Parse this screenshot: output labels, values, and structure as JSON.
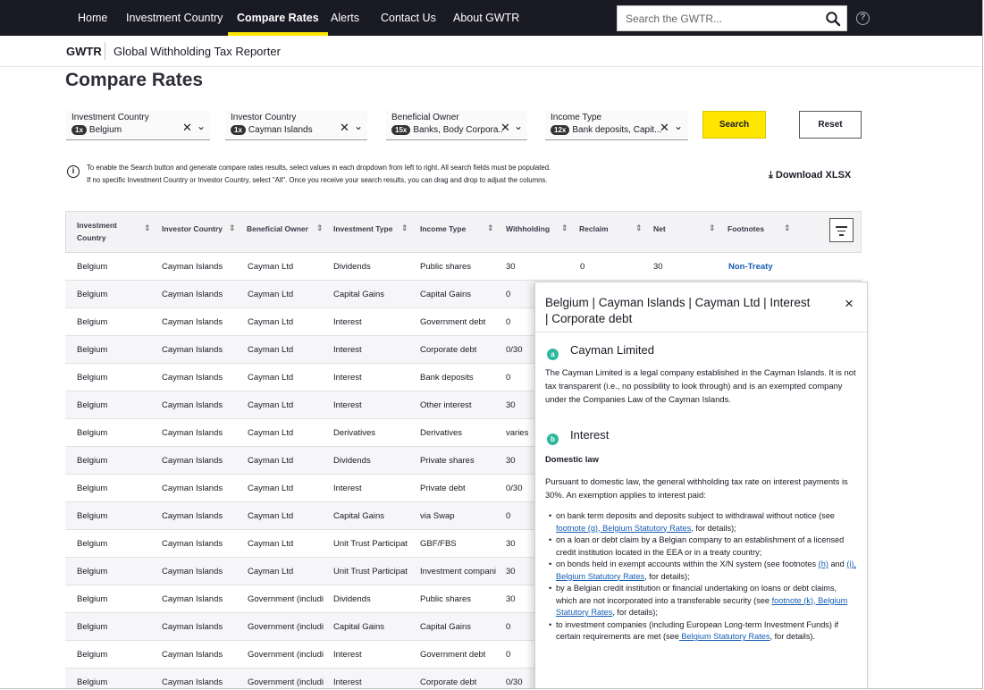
{
  "nav": {
    "items": [
      {
        "label": "Home",
        "active": false
      },
      {
        "label": "Investment Country",
        "active": false
      },
      {
        "label": "Compare Rates",
        "active": true
      },
      {
        "label": "Alerts",
        "active": false
      },
      {
        "label": "Contact Us",
        "active": false
      },
      {
        "label": "About GWTR",
        "active": false
      }
    ],
    "search_placeholder": "Search the GWTR...",
    "help_glyph": "?"
  },
  "breadcrumb": {
    "root": "GWTR",
    "current": "Global Withholding Tax Reporter"
  },
  "page_title": "Compare Rates",
  "filters": [
    {
      "label": "Investment Country",
      "count": "1x",
      "value": "Belgium"
    },
    {
      "label": "Investor Country",
      "count": "1x",
      "value": "Cayman Islands"
    },
    {
      "label": "Beneficial Owner",
      "count": "15x",
      "value": "Banks, Body Corpora..."
    },
    {
      "label": "Income Type",
      "count": "12x",
      "value": "Bank deposits, Capit..."
    }
  ],
  "buttons": {
    "search": "Search",
    "reset": "Reset",
    "download": "Download XLSX"
  },
  "info": {
    "line1": "To enable the Search button and generate compare rates results, select values in each dropdown from left to right. All search fields must be populated.",
    "line2": "If no specific Investment Country or Investor Country, select \"All\". Once you receive your search results, you can drag and drop to adjust the columns."
  },
  "table": {
    "headers": [
      "Investment Country",
      "Investor Country",
      "Beneficial Owner",
      "Investment Type",
      "Income Type",
      "Withholding",
      "Reclaim",
      "Net",
      "Footnotes"
    ],
    "rows": [
      [
        "Belgium",
        "Cayman Islands",
        "Cayman Ltd",
        "Dividends",
        "Public shares",
        "30",
        "0",
        "30",
        "Non-Treaty"
      ],
      [
        "Belgium",
        "Cayman Islands",
        "Cayman Ltd",
        "Capital Gains",
        "Capital Gains",
        "0",
        "",
        "",
        ""
      ],
      [
        "Belgium",
        "Cayman Islands",
        "Cayman Ltd",
        "Interest",
        "Government debt",
        "0",
        "",
        "",
        ""
      ],
      [
        "Belgium",
        "Cayman Islands",
        "Cayman Ltd",
        "Interest",
        "Corporate debt",
        "0/30",
        "",
        "",
        ""
      ],
      [
        "Belgium",
        "Cayman Islands",
        "Cayman Ltd",
        "Interest",
        "Bank deposits",
        "0",
        "",
        "",
        ""
      ],
      [
        "Belgium",
        "Cayman Islands",
        "Cayman Ltd",
        "Interest",
        "Other interest",
        "30",
        "",
        "",
        ""
      ],
      [
        "Belgium",
        "Cayman Islands",
        "Cayman Ltd",
        "Derivatives",
        "Derivatives",
        "varies",
        "",
        "",
        ""
      ],
      [
        "Belgium",
        "Cayman Islands",
        "Cayman Ltd",
        "Dividends",
        "Private shares",
        "30",
        "",
        "",
        ""
      ],
      [
        "Belgium",
        "Cayman Islands",
        "Cayman Ltd",
        "Interest",
        "Private debt",
        "0/30",
        "",
        "",
        ""
      ],
      [
        "Belgium",
        "Cayman Islands",
        "Cayman Ltd",
        "Capital Gains",
        "via Swap",
        "0",
        "",
        "",
        ""
      ],
      [
        "Belgium",
        "Cayman Islands",
        "Cayman Ltd",
        "Unit Trust Participat",
        "GBF/FBS",
        "30",
        "",
        "",
        ""
      ],
      [
        "Belgium",
        "Cayman Islands",
        "Cayman Ltd",
        "Unit Trust Participat",
        "Investment compani",
        "30",
        "",
        "",
        ""
      ],
      [
        "Belgium",
        "Cayman Islands",
        "Government (includi",
        "Dividends",
        "Public shares",
        "30",
        "",
        "",
        ""
      ],
      [
        "Belgium",
        "Cayman Islands",
        "Government (includi",
        "Capital Gains",
        "Capital Gains",
        "0",
        "",
        "",
        ""
      ],
      [
        "Belgium",
        "Cayman Islands",
        "Government (includi",
        "Interest",
        "Government debt",
        "0",
        "",
        "",
        ""
      ],
      [
        "Belgium",
        "Cayman Islands",
        "Government (includi",
        "Interest",
        "Corporate debt",
        "0/30",
        "",
        "",
        ""
      ]
    ]
  },
  "panel": {
    "title": "Belgium | Cayman Islands | Cayman Ltd | Interest | Corporate debt",
    "close": "×",
    "section_a": {
      "tag": "a",
      "heading": "Cayman Limited",
      "text": "The Cayman Limited is a legal company established in the Cayman Islands. It is not tax transparent (i.e., no possibility to look through) and is an exempted company under the Companies Law of the Cayman Islands."
    },
    "section_b": {
      "tag": "b",
      "heading": "Interest",
      "subheading": "Domestic law",
      "text": "Pursuant to domestic law, the general withholding tax rate on interest payments is 30%. An exemption applies to interest paid:",
      "bullets": [
        {
          "pre": "on bank term deposits and deposits subject to withdrawal without notice (see ",
          "link": "footnote (g), Belgium Statutory Rates",
          "mid": "",
          "link2": "",
          "post": ", for details);"
        },
        {
          "pre": "on a loan or debt claim by a Belgian company to an establishment of a licensed credit institution located in the EEA or in a treaty country;",
          "link": "",
          "mid": "",
          "link2": "",
          "post": ""
        },
        {
          "pre": "on bonds held in exempt accounts within the X/N system (see footnotes ",
          "link": "(h)",
          "mid": " and ",
          "link2": "(i), Belgium Statutory Rates",
          "post": ", for details);"
        },
        {
          "pre": "by a Belgian credit institution or financial undertaking on loans or debt claims, which are not incorporated into a transferable security (see ",
          "link": "footnote (k), Belgium Statutory Rates",
          "mid": "",
          "link2": "",
          "post": ", for details);"
        },
        {
          "pre": "to investment companies (including European Long-term Investment Funds) if certain requirements are met (see",
          "link": " Belgium Statutory Rates",
          "mid": "",
          "link2": "",
          "post": ", for details)."
        }
      ]
    }
  }
}
